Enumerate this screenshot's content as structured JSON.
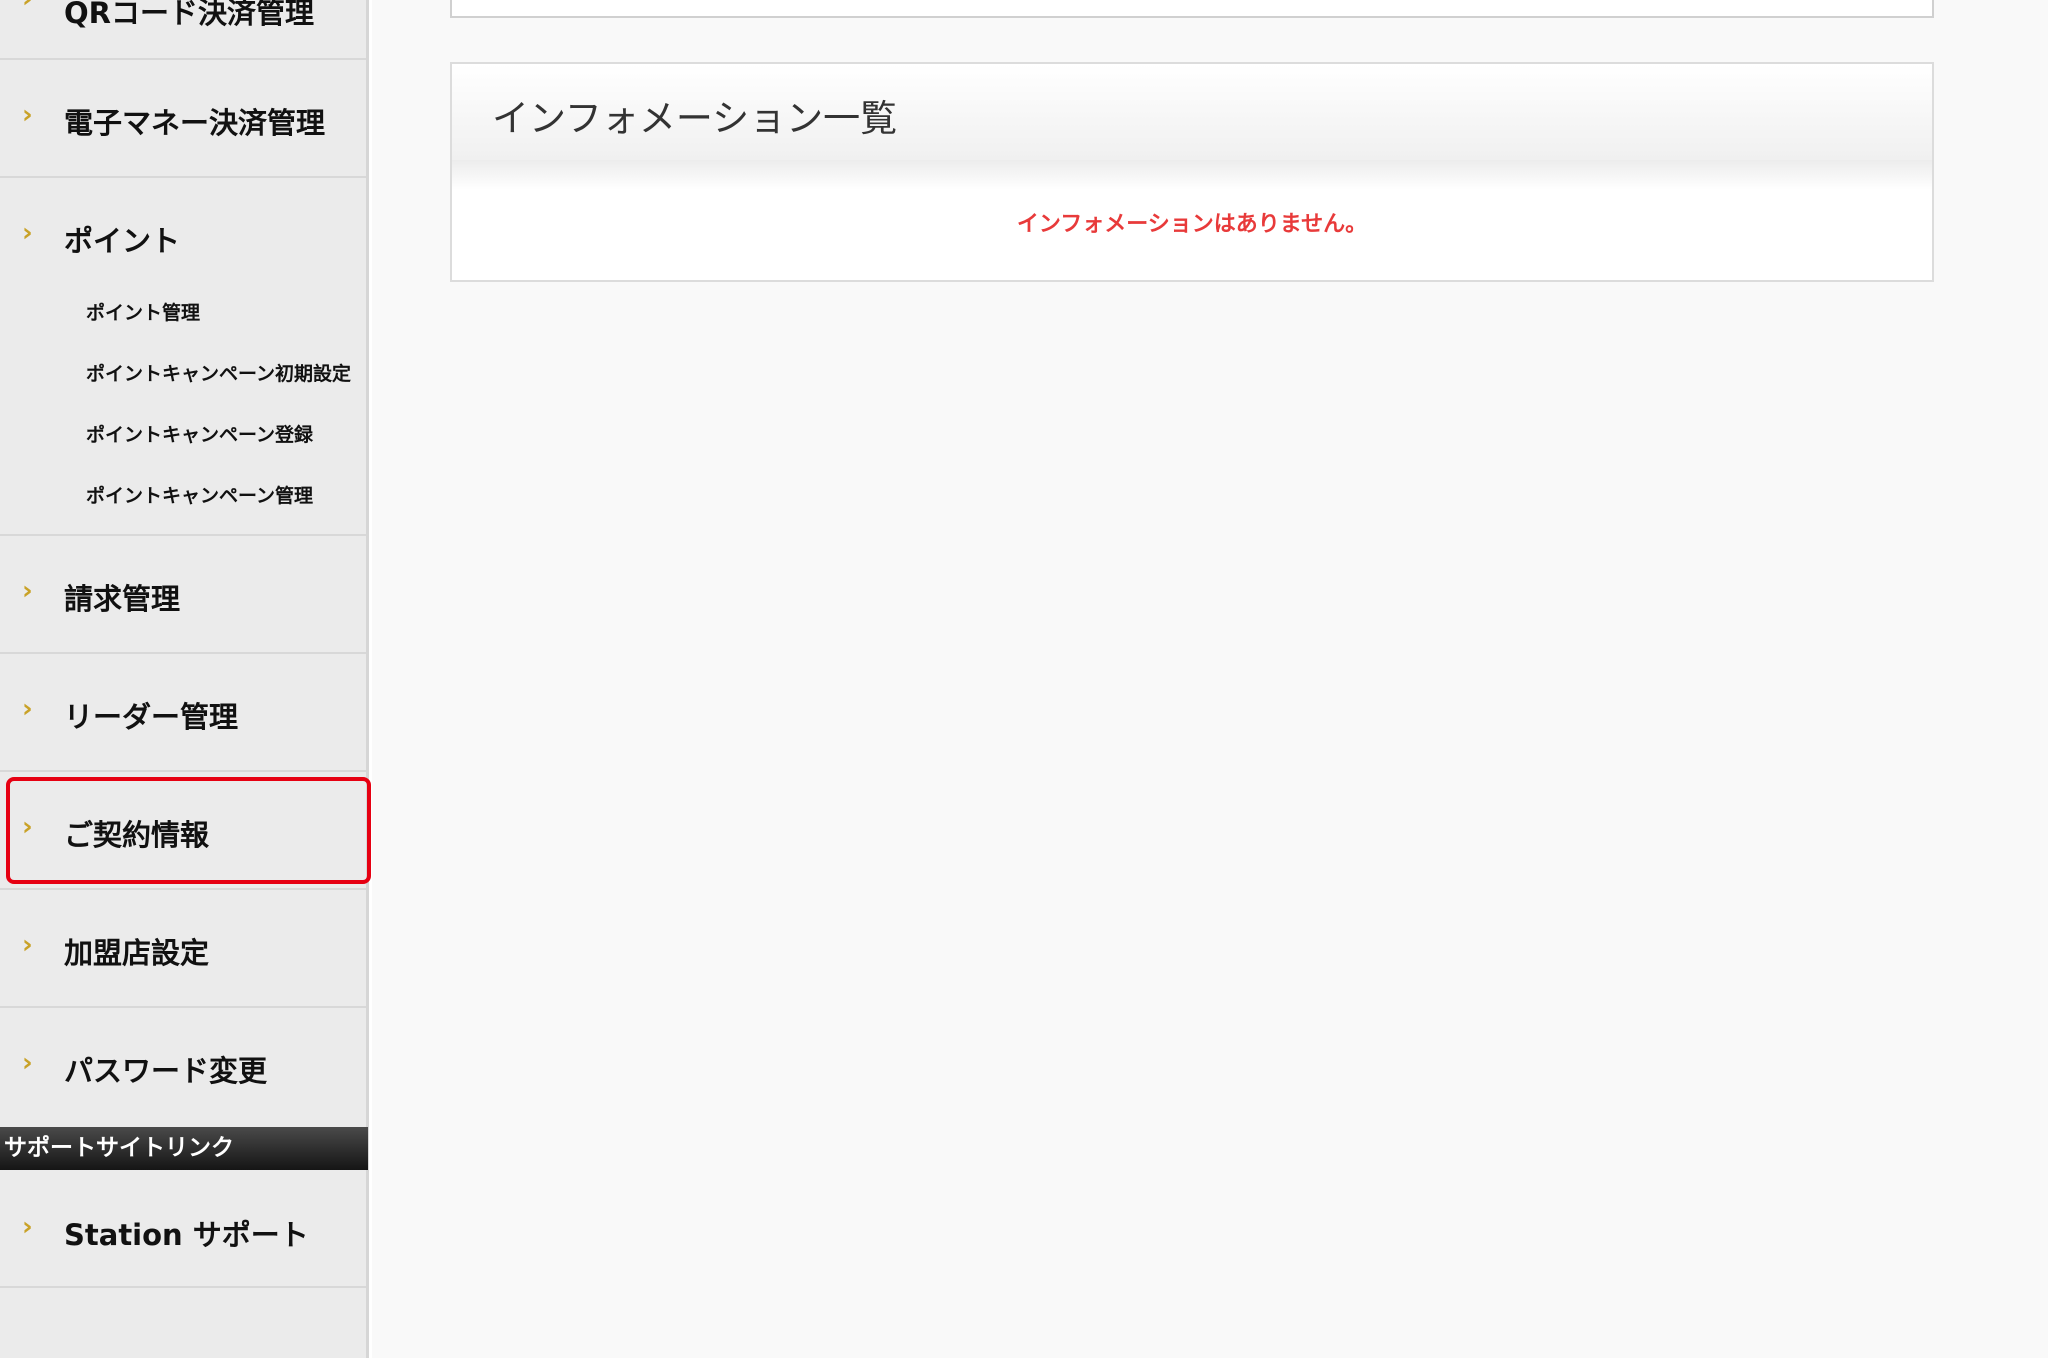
{
  "sidebar": {
    "items": [
      {
        "label": "QRコード決済管理"
      },
      {
        "label": "電子マネー決済管理"
      },
      {
        "label": "ポイント"
      },
      {
        "label": "請求管理"
      },
      {
        "label": "リーダー管理"
      },
      {
        "label": "ご契約情報"
      },
      {
        "label": "加盟店設定"
      },
      {
        "label": "パスワード変更"
      }
    ],
    "point_subitems": [
      {
        "label": "ポイント管理"
      },
      {
        "label": "ポイントキャンペーン初期設定"
      },
      {
        "label": "ポイントキャンペーン登録"
      },
      {
        "label": "ポイントキャンペーン管理"
      }
    ],
    "chevron": "›",
    "support_header": "サポートサイトリンク",
    "support_items": [
      {
        "label": "Station サポート"
      }
    ],
    "highlight_color": "#e60012",
    "chevron_color": "#c9a227"
  },
  "info": {
    "title": "インフォメーション一覧",
    "empty_message": "インフォメーションはありません。",
    "empty_color": "#e83a3a"
  }
}
